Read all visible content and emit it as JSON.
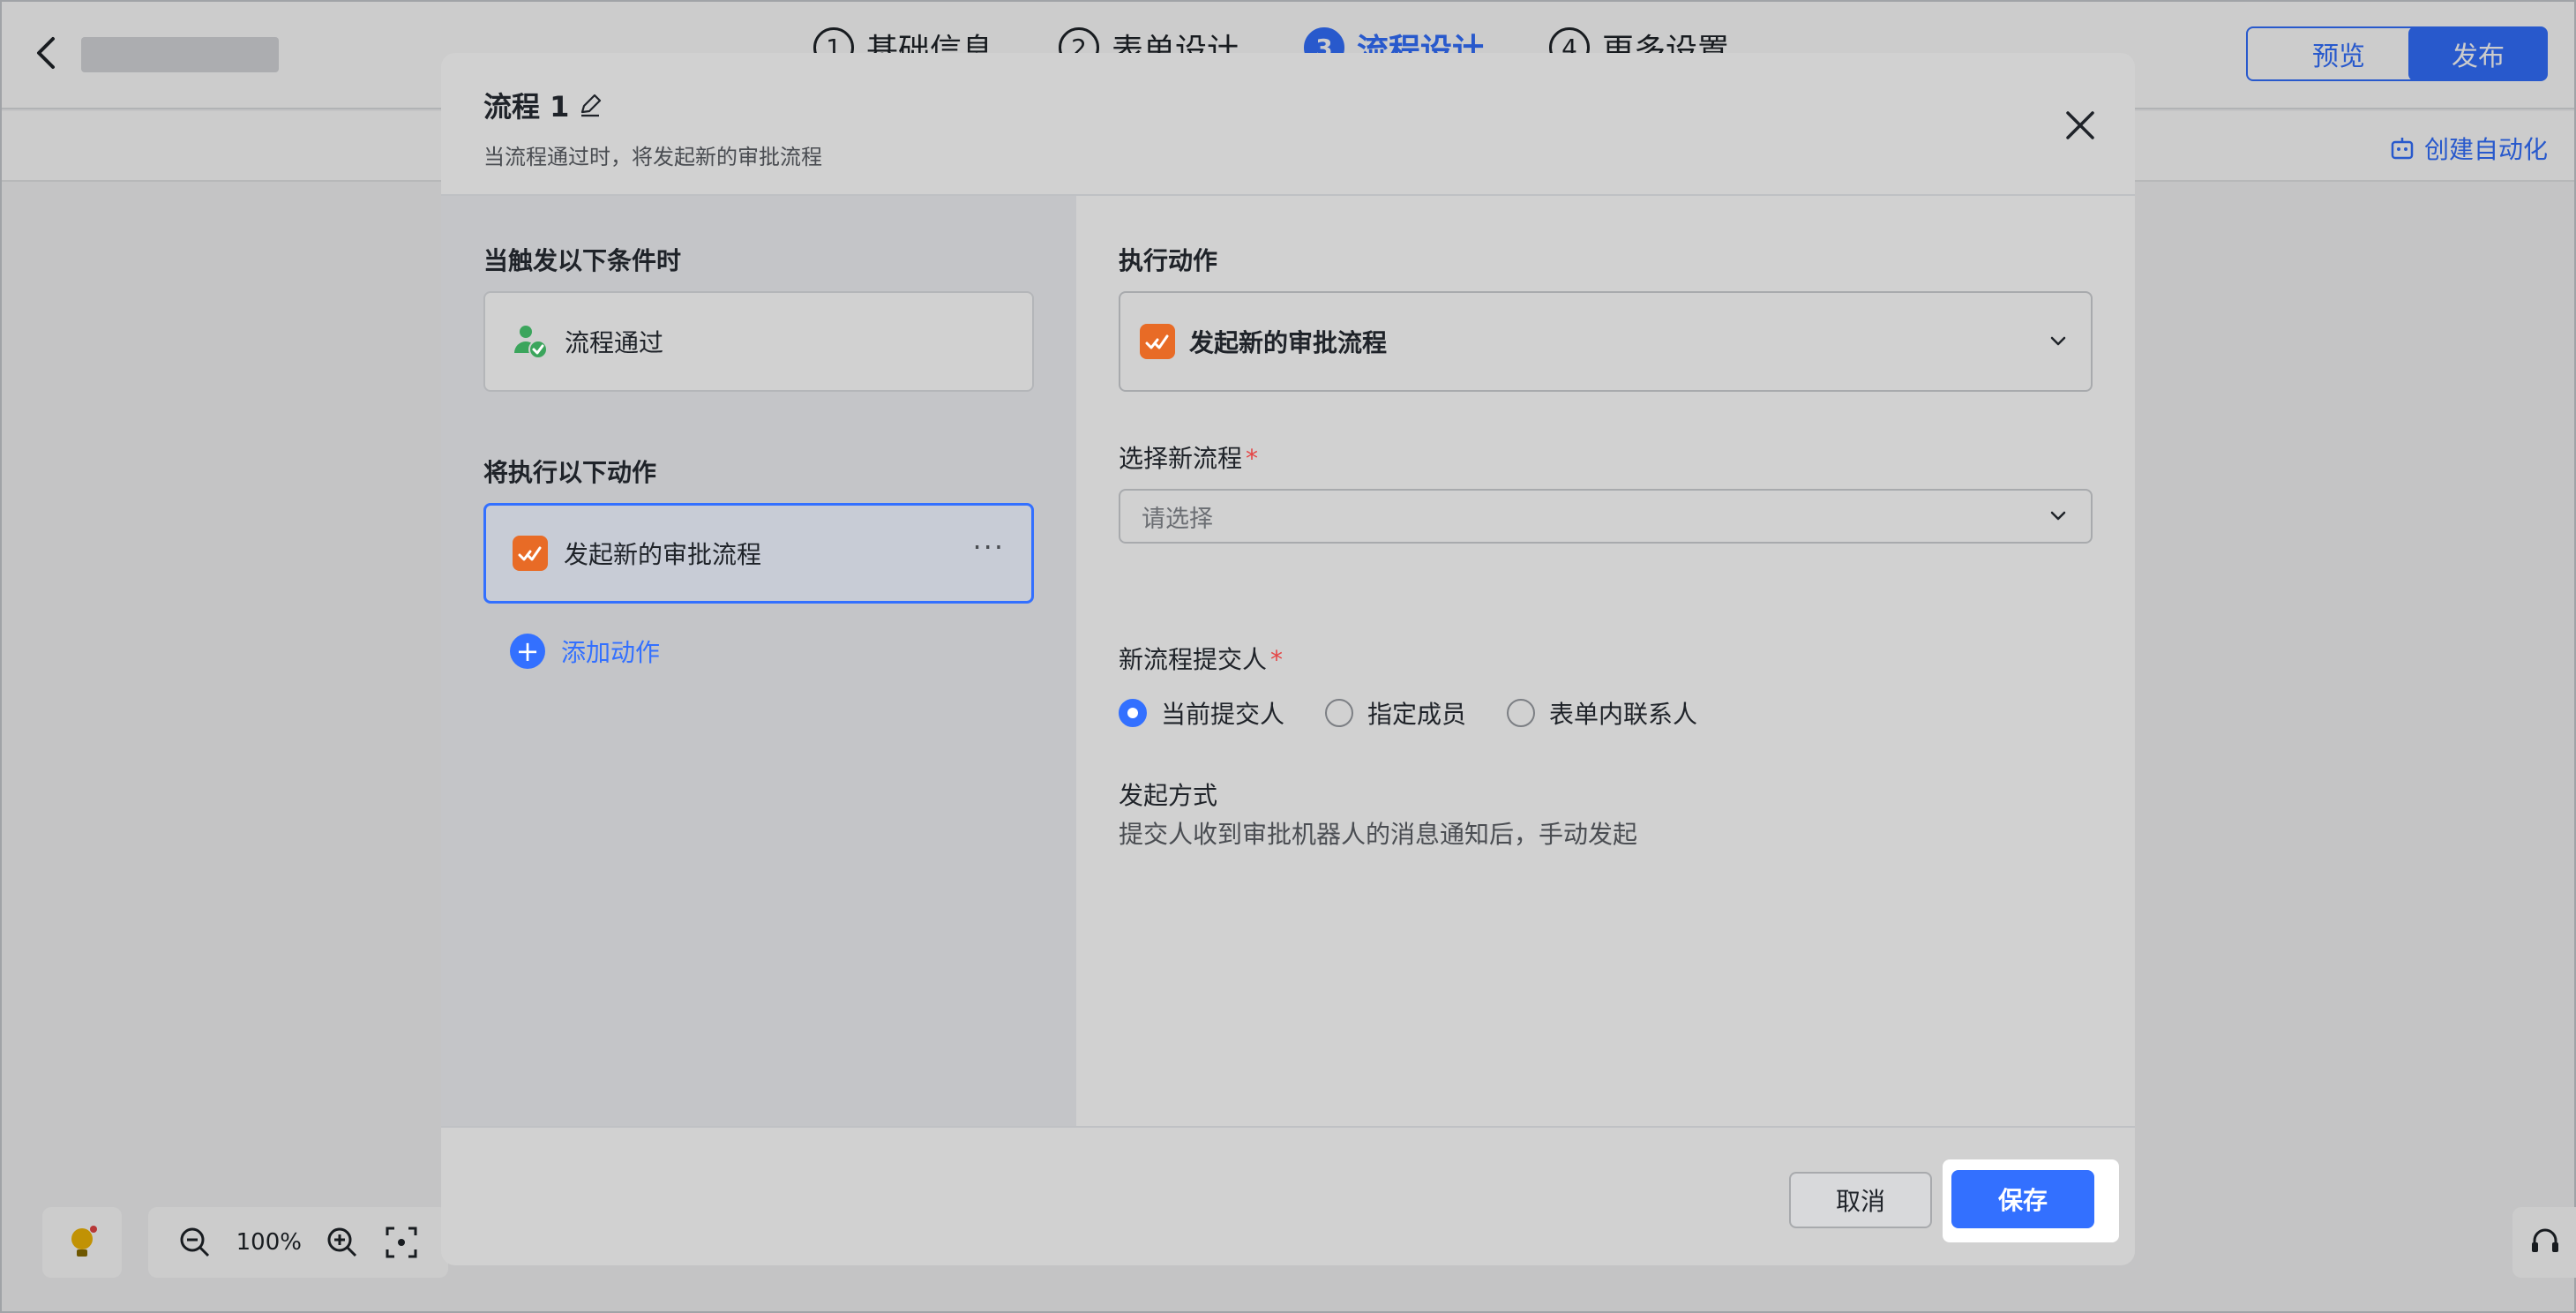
{
  "app": {
    "steps": [
      {
        "num": "1",
        "label": "基础信息"
      },
      {
        "num": "2",
        "label": "表单设计"
      },
      {
        "num": "3",
        "label": "流程设计"
      },
      {
        "num": "4",
        "label": "更多设置"
      }
    ],
    "preview_label": "预览",
    "publish_label": "发布",
    "create_automation_label": "创建自动化",
    "zoom_level": "100%"
  },
  "modal": {
    "title": "流程 1",
    "subtitle": "当流程通过时，将发起新的审批流程",
    "left": {
      "trigger_heading": "当触发以下条件时",
      "trigger_item": "流程通过",
      "actions_heading": "将执行以下动作",
      "action_item": "发起新的审批流程",
      "more_label": "···",
      "add_action_label": "添加动作"
    },
    "right": {
      "execute_heading": "执行动作",
      "execute_value": "发起新的审批流程",
      "select_flow_label": "选择新流程",
      "select_flow_placeholder": "请选择",
      "submitter_label": "新流程提交人",
      "required_mark": "*",
      "submitter_options": [
        "当前提交人",
        "指定成员",
        "表单内联系人"
      ],
      "submitter_selected": "当前提交人",
      "launch_mode_label": "发起方式",
      "launch_mode_desc": "提交人收到审批机器人的消息通知后，手动发起"
    },
    "footer": {
      "cancel_label": "取消",
      "save_label": "保存"
    }
  },
  "colors": {
    "accent": "#3370ff",
    "app_icon": "#e86b26",
    "trigger_icon": "#3ba55c",
    "required": "#e54545"
  }
}
